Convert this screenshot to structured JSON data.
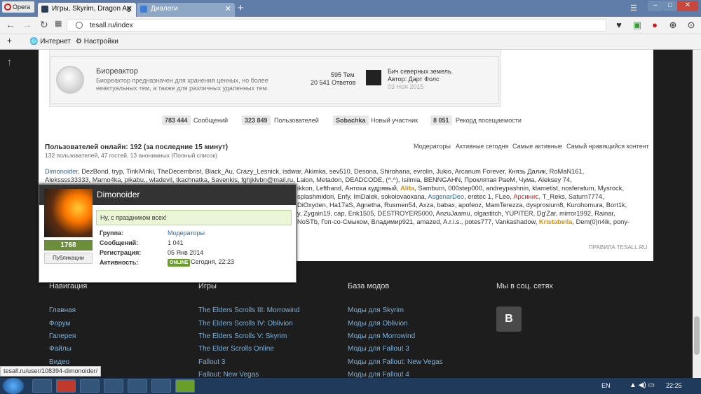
{
  "browser": {
    "menu_label": "Opera",
    "tabs": [
      {
        "label": "Игры, Skyrim, Dragon Ag",
        "active": true
      },
      {
        "label": "Диалоги",
        "active": false
      }
    ],
    "new_tab": "+",
    "url": "tesall.ru/index",
    "bookmarks": [
      {
        "label": "Интернет"
      },
      {
        "label": "Настройки"
      }
    ],
    "window_buttons": {
      "minimize": "–",
      "maximize": "□",
      "close": "✕"
    }
  },
  "forum": {
    "title": "Биореактор",
    "desc_line1": "Биореактор предназначен для хранения ценных, но более",
    "desc_line2": "неактуальных тем, а также для различных удаленных тем.",
    "topics": "595 Тем",
    "posts": "20 541 Ответов",
    "last_post": {
      "title": "Бич северных земель.",
      "author": "Автор: Дарт Фолс",
      "date": "03 Ноя 2015"
    }
  },
  "stats": [
    {
      "value": "783 444",
      "label": "Сообщений"
    },
    {
      "value": "323 849",
      "label": "Пользователей"
    },
    {
      "value": "Sobachka",
      "label": "Новый участник"
    },
    {
      "value": "8 051",
      "label": "Рекорд посещаемости"
    }
  ],
  "online": {
    "title": "Пользователей онлайн: 192 (за последние 15 минут)",
    "subtitle": "132 пользователей, 47 гостей, 13 анонимных  (Полный список)",
    "links": [
      "Модераторы",
      "Активные сегодня",
      "Самые активные",
      "Самый нравящийся контент"
    ],
    "lines": [
      {
        "main": "DezBond, tryp, TinkiVinki, TheDecembrist, Black_Au, Crazy_Lesnick, isdwar, Akimka, sev510, Desona, Shirohana, evrolin, Jukio, Arcanum Forever, Князь Далик, RoMaN161,",
        "first": "Dimonoider, "
      },
      {
        "main": "Alekssss33333, Mamo4ka, pikabu., wladevil, tkachnatka, Savenkis, fghjklvbn@mail.ru, Laion, Metadon, DEADCODE, (^.^), Isilmia, BENNGAHN, Проклятая РаеМ, Чума, Aleksey 74,"
      },
      {
        "main": "ikkon, Lefthand, Антоха кудрявый, ",
        "hl": "Alita",
        "rest": ", Samburn, 000step000, andreypashnin, klametist, nosferatum, Mysrock,"
      },
      {
        "main": "splashmidori, Enfy, ImDalek, sokolovaoxana, ",
        "hl": "AsgenarDeo",
        "rest": ", eretec 1, FLeo, ",
        "hl2": "Арсинис",
        "rest2": ", T_Reks, Saturn7774,"
      },
      {
        "main": "DiOxyden, Ha17aS, Agnetha, Rusmen54, Axza, babax, apofeoz, MamTerezza, dysprosium8, Kurohomura, Bort1k,"
      },
      {
        "main": "y, Zygain19, cap, Erik1505, DESTROYER5000, AnzuJaamu, olgastitch, YUPITER, Dg'Zar, mirror1992, Rainar,"
      },
      {
        "main": "NoSTb, Гоп-со-Смыком, Владимир921, amazed, A.r.i.s., potes777, Vankashadow, ",
        "hl": "Kristabella",
        "rest": ", Dem(0)n4ik, pony-"
      }
    ],
    "rules": "ПРАВИЛА TESALL.RU"
  },
  "popup": {
    "username": "Dimonoider",
    "reputation": "1768",
    "publications_button": "Публикации",
    "status_message": "Ну, с праздником всех!",
    "rows": [
      {
        "label": "Группа:",
        "value": "Модераторы"
      },
      {
        "label": "Сообщений:",
        "value": "1 041"
      },
      {
        "label": "Регистрация:",
        "value": "05 Янв 2014"
      },
      {
        "label": "Активность:",
        "value": "Сегодня, 22:23"
      }
    ],
    "online_badge": "ONLINE"
  },
  "footer": {
    "columns": [
      {
        "title": "Навигация",
        "links": [
          "Главная",
          "Форум",
          "Галерея",
          "Файлы",
          "Видео"
        ]
      },
      {
        "title": "Игры",
        "links": [
          "The Elders Scrolls III: Morrowind",
          "The Elders Scrolls IV: Oblivion",
          "The Elders Scrolls V: Skyrim",
          "The Elder Scrolls Online",
          "Fallout 3",
          "Fallout: New Vegas"
        ]
      },
      {
        "title": "База модов",
        "links": [
          "Моды для Skyrim",
          "Моды для Oblivion",
          "Моды для Morrowind",
          "Моды для Fallout 3",
          "Моды для Fallout: New Vegas",
          "Моды для Fallout 4"
        ]
      },
      {
        "title": "Мы в соц. сетях",
        "vk": "B"
      }
    ]
  },
  "statusbar_url": "tesall.ru/user/108394-dimonoider/",
  "taskbar": {
    "lang": "EN",
    "time": "22:25"
  }
}
